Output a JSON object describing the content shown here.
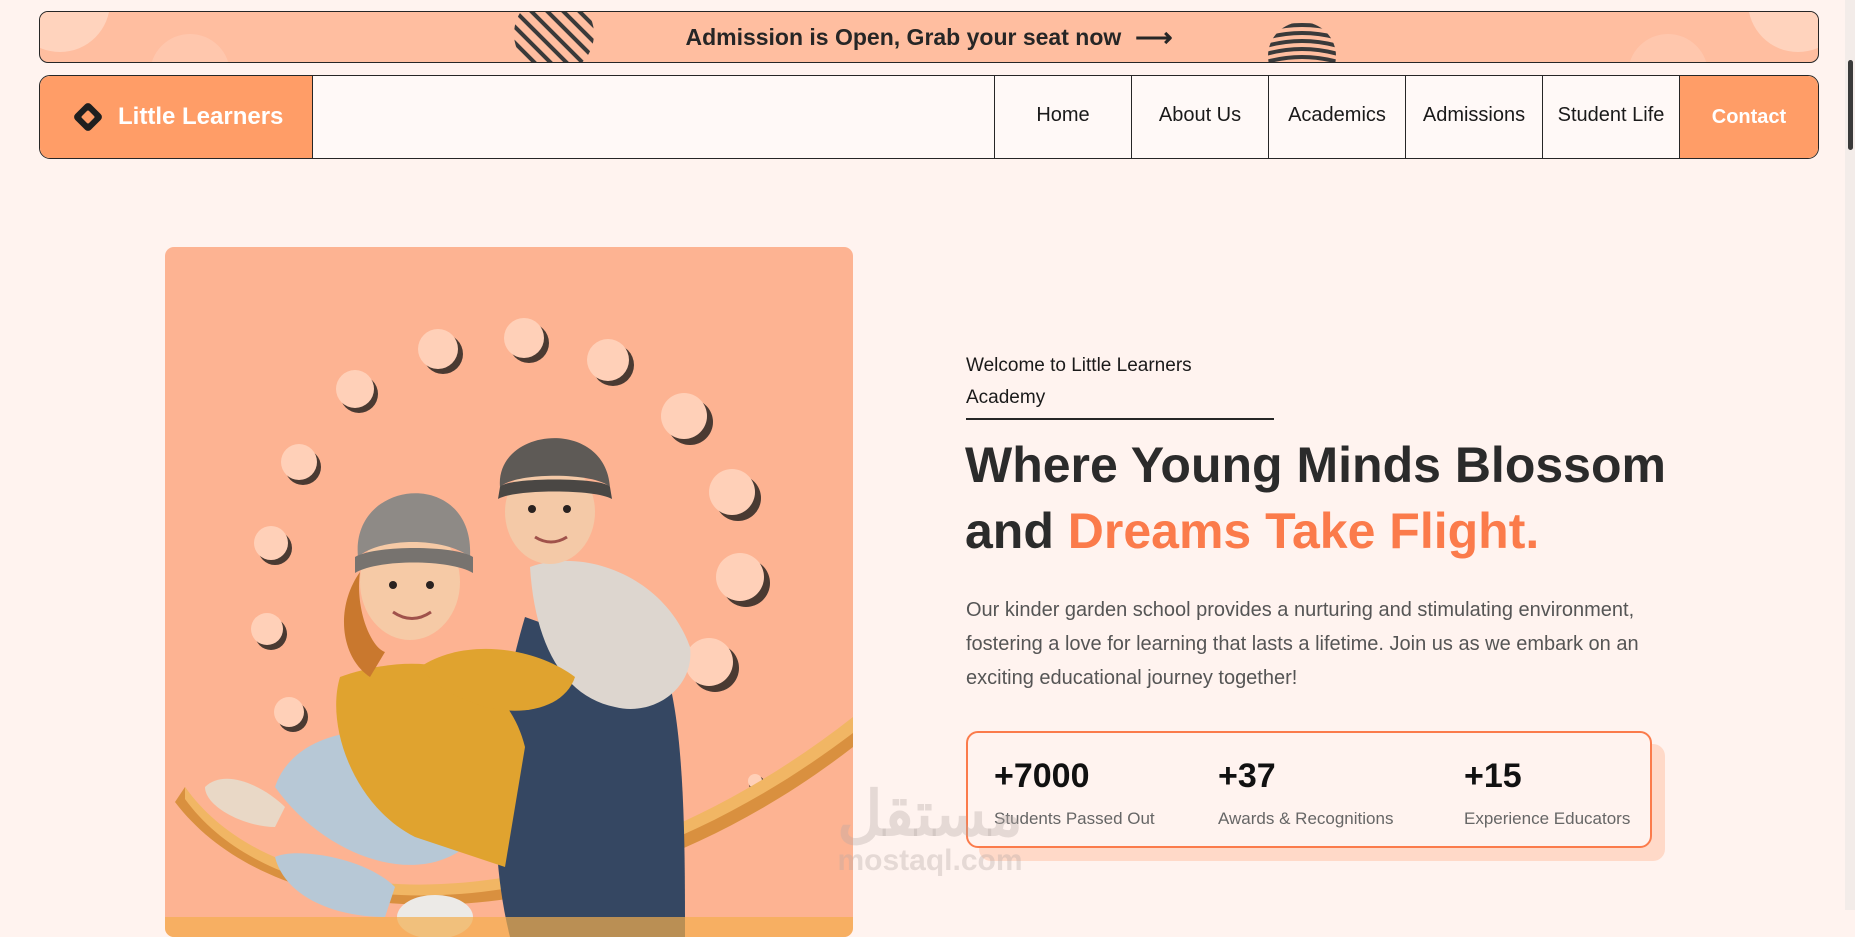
{
  "banner": {
    "text": "Admission is Open, Grab your seat now",
    "arrow_icon": "arrow-right-icon"
  },
  "nav": {
    "brand": "Little Learners",
    "brand_icon": "diamond-logo-icon",
    "items": [
      {
        "label": "Home"
      },
      {
        "label": "About Us"
      },
      {
        "label": "Academics"
      },
      {
        "label": "Admissions"
      },
      {
        "label": "Student Life"
      }
    ],
    "contact": "Contact"
  },
  "hero": {
    "eyebrow": "Welcome to Little Learners Academy",
    "headline_plain": "Where Young Minds Blossom and ",
    "headline_accent": "Dreams Take Flight.",
    "description": "Our kinder garden school provides a nurturing and stimulating environment, fostering a love for learning that lasts a lifetime. Join us as we embark on an exciting educational journey together!",
    "stats": [
      {
        "value": "+7000",
        "label": "Students Passed Out"
      },
      {
        "value": "+37",
        "label": "Awards & Recognitions"
      },
      {
        "value": "+15",
        "label": "Experience Educators"
      }
    ]
  },
  "watermark": {
    "arabic": "مستقل",
    "latin": "mostaql.com"
  },
  "colors": {
    "accent": "#fb7b4b",
    "brand_orange": "#ff9d67",
    "banner_peach": "#ffbea0",
    "page_bg": "#fff3ef",
    "hero_image_bg": "#fdb392"
  }
}
